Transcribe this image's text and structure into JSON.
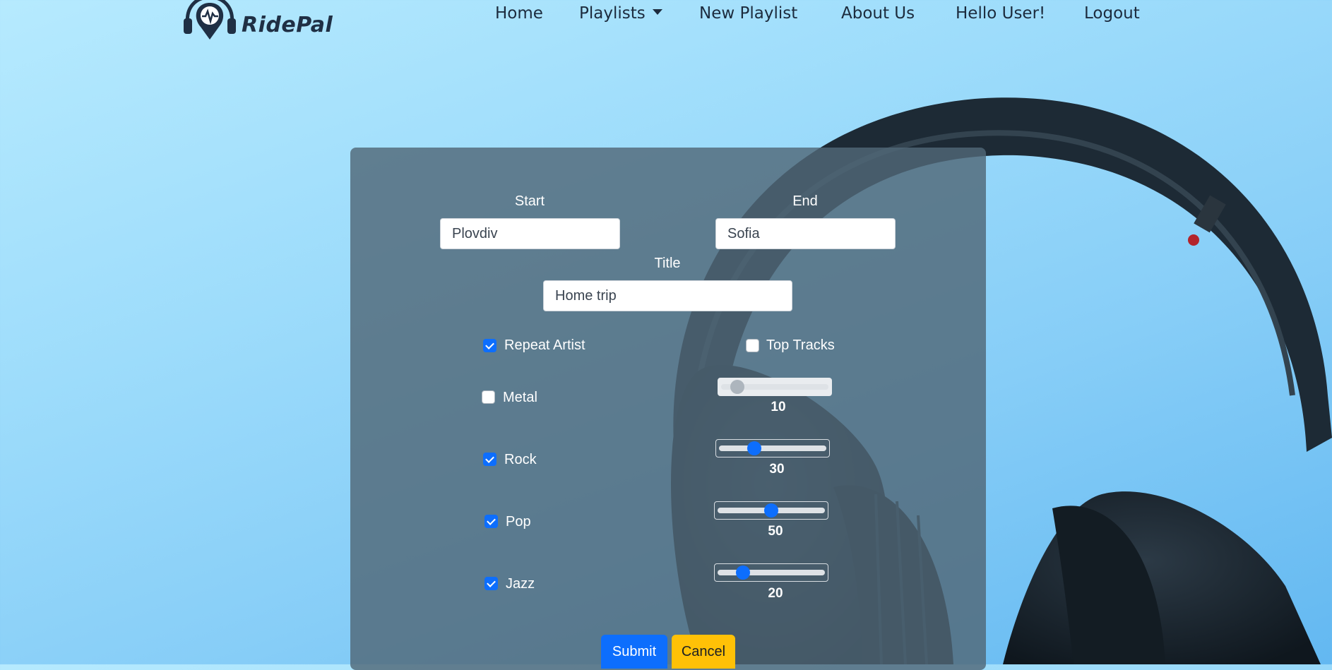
{
  "brand": {
    "name": "RidePal"
  },
  "nav": {
    "home": "Home",
    "playlists": "Playlists",
    "new_playlist": "New Playlist",
    "about": "About Us",
    "greeting": "Hello User!",
    "logout": "Logout"
  },
  "form": {
    "start_label": "Start",
    "start_value": "Plovdiv",
    "end_label": "End",
    "end_value": "Sofia",
    "title_label": "Title",
    "title_value": "Home trip",
    "repeat_artist": {
      "label": "Repeat Artist",
      "checked": true
    },
    "top_tracks": {
      "label": "Top Tracks",
      "checked": false
    },
    "genres": [
      {
        "label": "Metal",
        "checked": false,
        "value": "10",
        "level": 0.1
      },
      {
        "label": "Rock",
        "checked": true,
        "value": "30",
        "level": 0.3
      },
      {
        "label": "Pop",
        "checked": true,
        "value": "50",
        "level": 0.5
      },
      {
        "label": "Jazz",
        "checked": true,
        "value": "20",
        "level": 0.2
      }
    ],
    "submit_label": "Submit",
    "cancel_label": "Cancel"
  },
  "colors": {
    "primary": "#0d6efd",
    "warning": "#ffc107",
    "panel": "#506878"
  },
  "icons": {
    "logo": "headphones-pin-icon",
    "background": "headphones-image"
  }
}
